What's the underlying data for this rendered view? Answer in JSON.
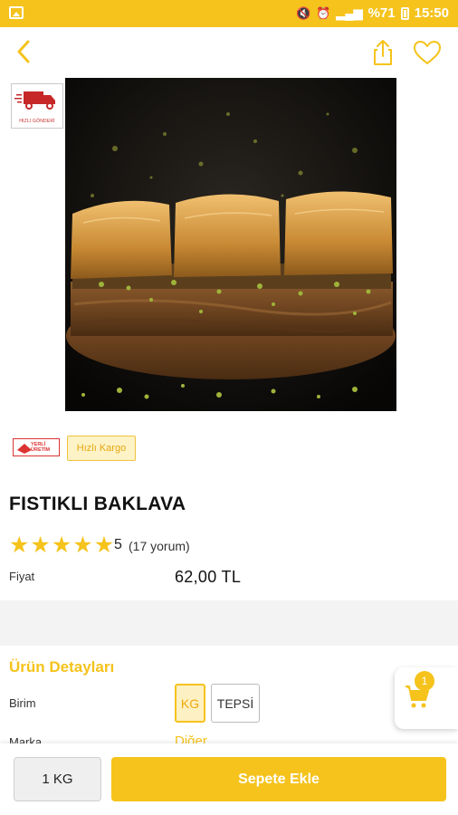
{
  "status_bar": {
    "battery_text": "%71",
    "time": "15:50"
  },
  "product": {
    "name": "FISTIKLI BAKLAVA",
    "image_badge_text": "HIZLI GÖNDERİ",
    "tags": {
      "domestic_text": "YERLİ ÜRETİM",
      "cargo": "Hızlı Kargo"
    },
    "rating": {
      "value": "5",
      "count": "(17 yorum)",
      "stars": 5
    },
    "price_label": "Fiyat",
    "price": "62,00 TL"
  },
  "details": {
    "title": "Ürün Detayları",
    "unit_label": "Birim",
    "unit_options": [
      "KG",
      "TEPSİ"
    ],
    "selected_unit": "KG",
    "brand_label": "Marka",
    "brand_value": "Diğer"
  },
  "cart": {
    "badge_count": "1"
  },
  "bottom": {
    "quantity": "1 KG",
    "add_to_cart": "Sepete Ekle"
  },
  "colors": {
    "accent": "#f5c31c",
    "accent_light": "#fdf0c2",
    "brand_red": "#d33333"
  }
}
